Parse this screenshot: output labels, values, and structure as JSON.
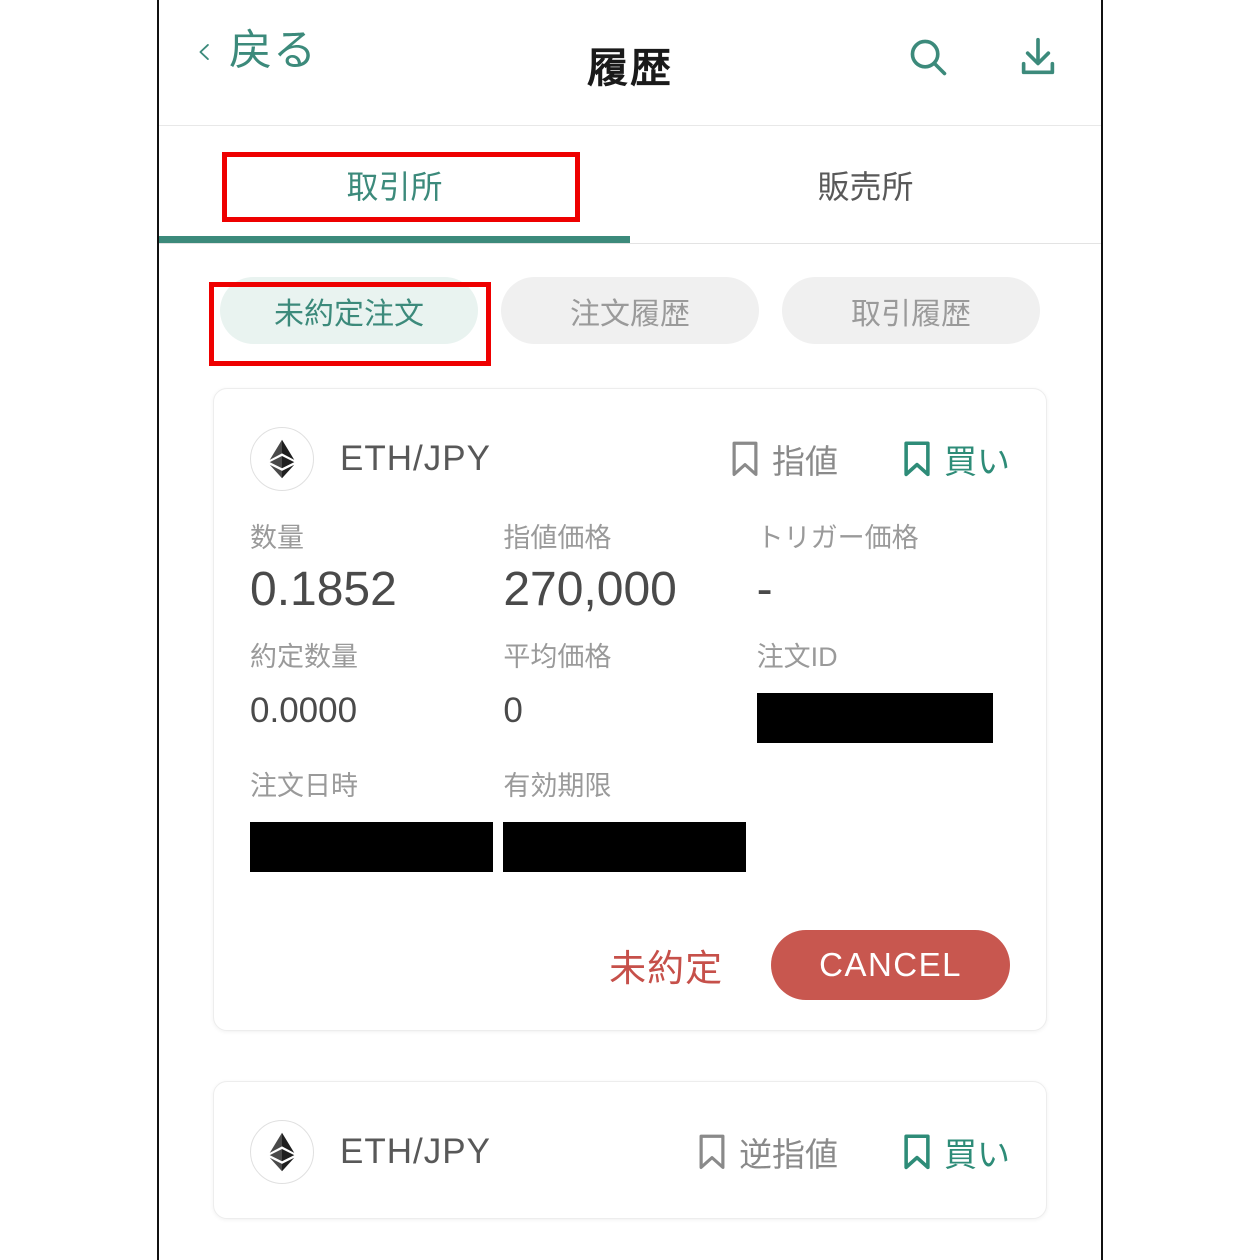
{
  "header": {
    "back_label": "戻る",
    "title": "履歴",
    "back_icon": "chevron-left-icon",
    "search_icon": "search-icon",
    "download_icon": "download-icon"
  },
  "tabs": [
    {
      "label": "取引所",
      "active": true
    },
    {
      "label": "販売所",
      "active": false
    }
  ],
  "filter_pills": [
    {
      "label": "未約定注文",
      "active": true
    },
    {
      "label": "注文履歴",
      "active": false
    },
    {
      "label": "取引履歴",
      "active": false
    }
  ],
  "orders": [
    {
      "pair": "ETH/JPY",
      "coin_icon": "ethereum-icon",
      "order_type": "指値",
      "side": "買い",
      "fields": [
        {
          "label": "数量",
          "value": "0.1852",
          "redacted": false
        },
        {
          "label": "指値価格",
          "value": "270,000",
          "redacted": false
        },
        {
          "label": "トリガー価格",
          "value": "-",
          "redacted": false
        },
        {
          "label": "約定数量",
          "value": "0.0000",
          "redacted": false
        },
        {
          "label": "平均価格",
          "value": "0",
          "redacted": false
        },
        {
          "label": "注文ID",
          "value": "",
          "redacted": true
        },
        {
          "label": "注文日時",
          "value": "",
          "redacted": true
        },
        {
          "label": "有効期限",
          "value": "",
          "redacted": true
        }
      ],
      "status": "未約定",
      "cancel_label": "CANCEL"
    },
    {
      "pair": "ETH/JPY",
      "coin_icon": "ethereum-icon",
      "order_type": "逆指値",
      "side": "買い"
    }
  ],
  "colors": {
    "teal": "#3c8a7b",
    "pill_active_bg": "#e9f3f0",
    "pill_inactive_bg": "#f0f0f0",
    "cancel_red": "#c8574f",
    "status_red": "#c6504a",
    "annotation_red": "#ee0000"
  }
}
